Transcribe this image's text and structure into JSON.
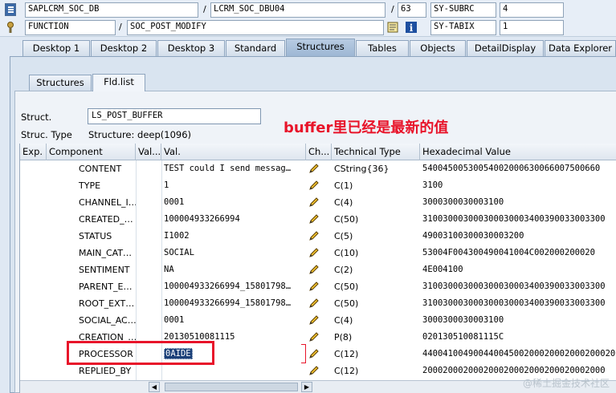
{
  "top": {
    "program": "SAPLCRM_SOC_DB",
    "include": "LCRM_SOC_DBU04",
    "line": "63",
    "var1_name": "SY-SUBRC",
    "var1_value": "4",
    "event_type": "FUNCTION",
    "event_name": "SOC_POST_MODIFY",
    "var2_name": "SY-TABIX",
    "var2_value": "1",
    "sep1": "/",
    "sep2": "/",
    "sep3": "/"
  },
  "tabs": [
    {
      "label": "Desktop 1"
    },
    {
      "label": "Desktop 2"
    },
    {
      "label": "Desktop 3"
    },
    {
      "label": "Standard"
    },
    {
      "label": "Structures"
    },
    {
      "label": "Tables"
    },
    {
      "label": "Objects"
    },
    {
      "label": "DetailDisplay"
    },
    {
      "label": "Data Explorer"
    }
  ],
  "subtabs": [
    {
      "label": "Structures"
    },
    {
      "label": "Fld.list"
    }
  ],
  "struct": {
    "label": "Struct.",
    "value": "LS_POST_BUFFER",
    "type_label": "Struc. Type",
    "type_value": "Structure: deep(1096)"
  },
  "annotation": "buffer里已经是最新的值",
  "grid": {
    "headers": {
      "exp": "Exp.",
      "component": "Component",
      "val1": "Val...",
      "val": "Val.",
      "ch": "Ch...",
      "tech": "Technical Type",
      "hex": "Hexadecimal Value"
    },
    "rows": [
      {
        "component": "CONTENT",
        "val": "TEST could I send messag…",
        "tech": "CString{36}",
        "hex": "54004500530054002000630066007500660"
      },
      {
        "component": "TYPE",
        "val": "1",
        "tech": "C(1)",
        "hex": "3100"
      },
      {
        "component": "CHANNEL_I…",
        "val": "0001",
        "tech": "C(4)",
        "hex": "3000300030003100"
      },
      {
        "component": "CREATED_…",
        "val": "100004933266994",
        "tech": "C(50)",
        "hex": "310030003000300030003400390033003300"
      },
      {
        "component": "STATUS",
        "val": "I1002",
        "tech": "C(5)",
        "hex": "49003100300030003200"
      },
      {
        "component": "MAIN_CAT…",
        "val": "SOCIAL",
        "tech": "C(10)",
        "hex": "53004F004300490041004C002000200020"
      },
      {
        "component": "SENTIMENT",
        "val": "NA",
        "tech": "C(2)",
        "hex": "4E004100"
      },
      {
        "component": "PARENT_E…",
        "val": "100004933266994_15801798…",
        "tech": "C(50)",
        "hex": "310030003000300030003400390033003300"
      },
      {
        "component": "ROOT_EXT…",
        "val": "100004933266994_15801798…",
        "tech": "C(50)",
        "hex": "310030003000300030003400390033003300"
      },
      {
        "component": "SOCIAL_AC…",
        "val": "0001",
        "tech": "C(4)",
        "hex": "3000300030003100"
      },
      {
        "component": "CREATION_…",
        "val": "20130510081115",
        "tech": "P(8)",
        "hex": "020130510081115C"
      },
      {
        "component": "PROCESSOR",
        "val": "0AIDE",
        "tech": "C(12)",
        "hex": "44004100490044004500200020002000200020"
      },
      {
        "component": "REPLIED_BY",
        "val": "",
        "tech": "C(12)",
        "hex": "200020002000200020002000200020002000"
      }
    ]
  },
  "watermark": "@稀土掘金技术社区"
}
